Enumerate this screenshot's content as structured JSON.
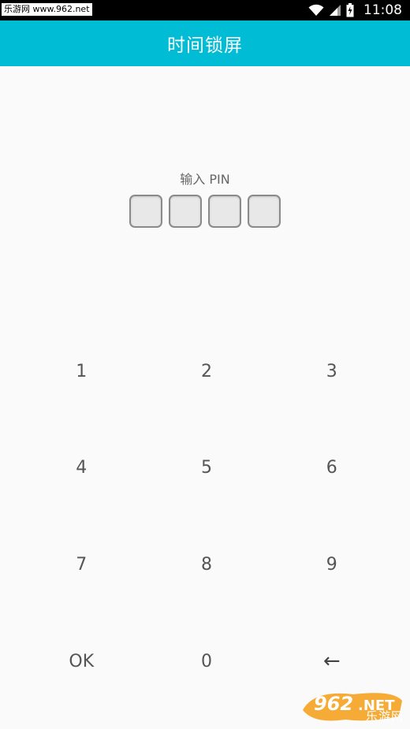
{
  "status_bar": {
    "watermark_site": "乐游网 www.962.net",
    "time": "11:08",
    "icons": [
      "wifi-icon",
      "signal-icon",
      "battery-charging-icon"
    ]
  },
  "app_bar": {
    "title": "时间锁屏",
    "color": "#00bcd4"
  },
  "pin": {
    "label": "输入 PIN",
    "digits_entered": 0,
    "length": 4
  },
  "keypad": {
    "keys": [
      "1",
      "2",
      "3",
      "4",
      "5",
      "6",
      "7",
      "8",
      "9",
      "OK",
      "0",
      "←"
    ]
  },
  "footer_watermark": {
    "brand": "962.NET",
    "subtitle": "乐游网"
  }
}
